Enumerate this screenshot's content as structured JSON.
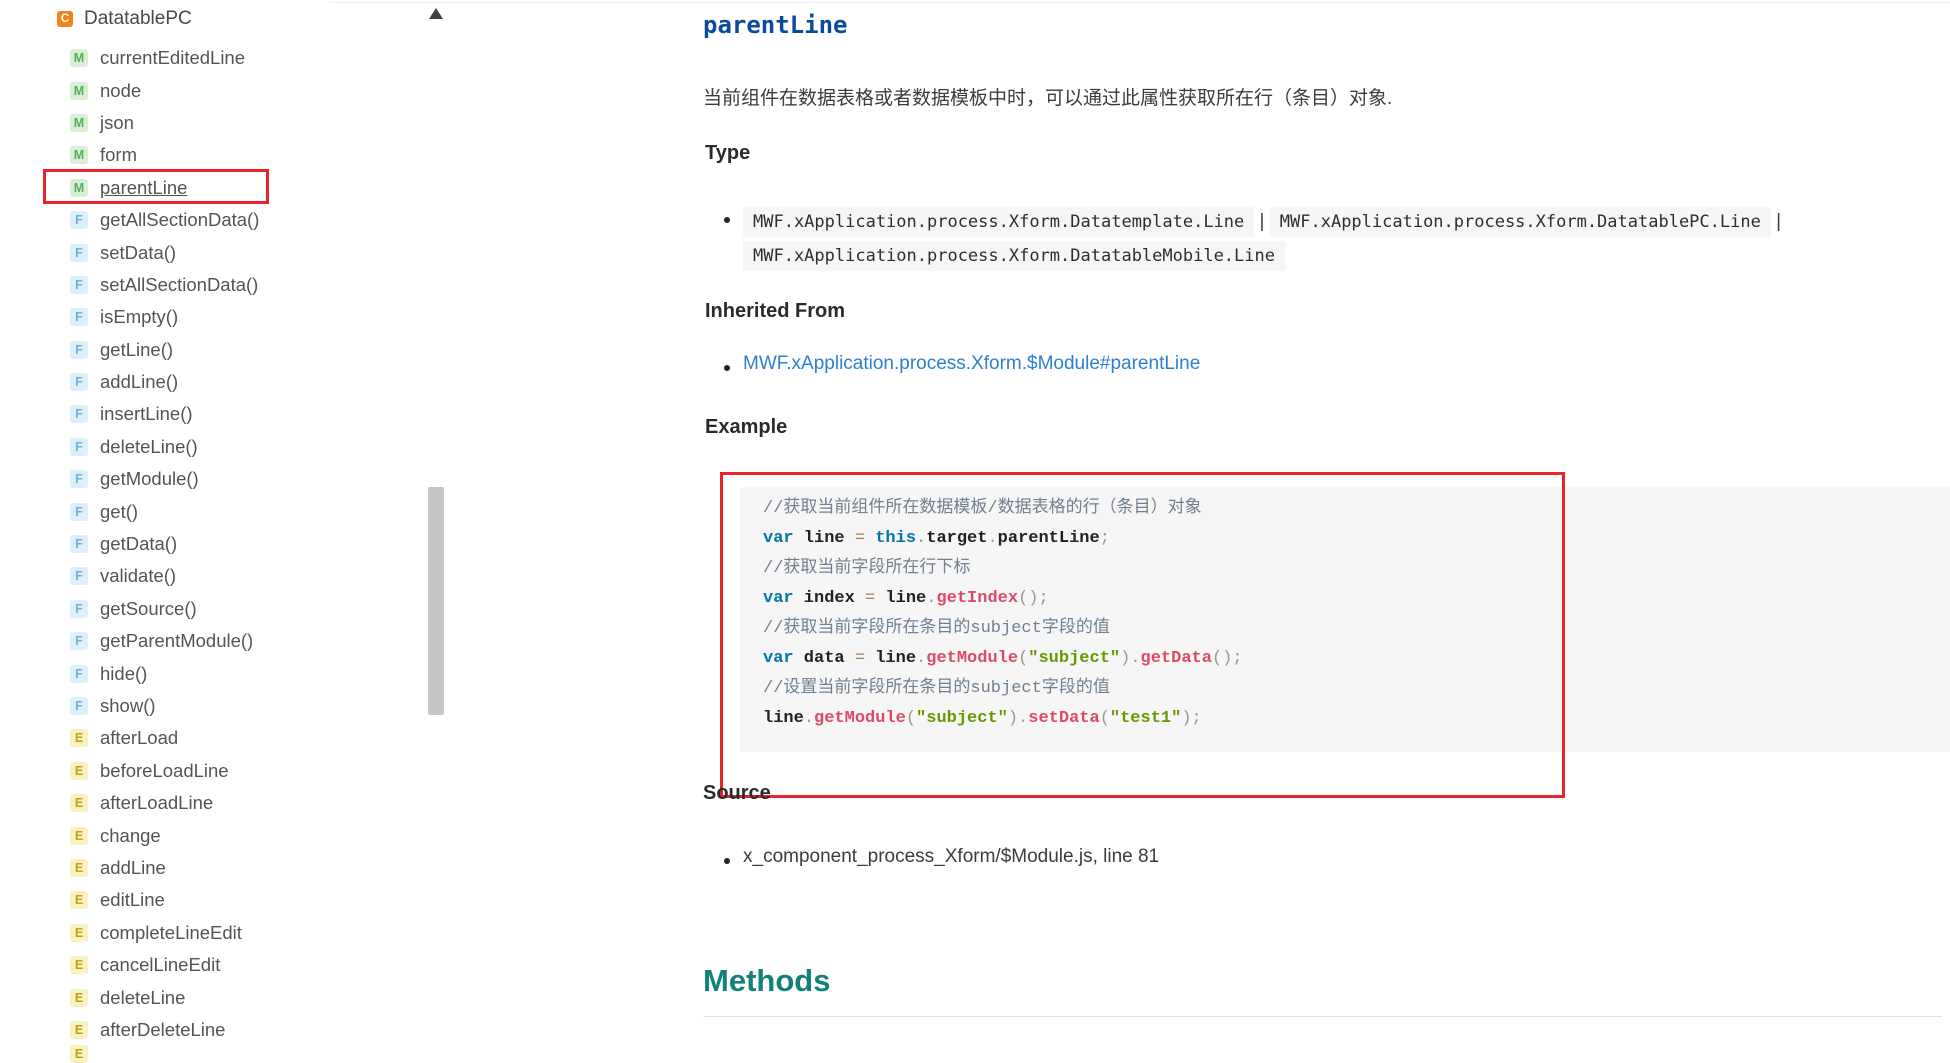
{
  "sidebar": {
    "header": {
      "badge": "C",
      "label": "DatatablePC"
    },
    "items": [
      {
        "badge": "M",
        "label": "currentEditedLine"
      },
      {
        "badge": "M",
        "label": "node"
      },
      {
        "badge": "M",
        "label": "json"
      },
      {
        "badge": "M",
        "label": "form"
      },
      {
        "badge": "M",
        "label": "parentLine",
        "highlighted": true
      },
      {
        "badge": "F",
        "label": "getAllSectionData()"
      },
      {
        "badge": "F",
        "label": "setData()"
      },
      {
        "badge": "F",
        "label": "setAllSectionData()"
      },
      {
        "badge": "F",
        "label": "isEmpty()"
      },
      {
        "badge": "F",
        "label": "getLine()"
      },
      {
        "badge": "F",
        "label": "addLine()"
      },
      {
        "badge": "F",
        "label": "insertLine()"
      },
      {
        "badge": "F",
        "label": "deleteLine()"
      },
      {
        "badge": "F",
        "label": "getModule()"
      },
      {
        "badge": "F",
        "label": "get()"
      },
      {
        "badge": "F",
        "label": "getData()"
      },
      {
        "badge": "F",
        "label": "validate()"
      },
      {
        "badge": "F",
        "label": "getSource()"
      },
      {
        "badge": "F",
        "label": "getParentModule()"
      },
      {
        "badge": "F",
        "label": "hide()"
      },
      {
        "badge": "F",
        "label": "show()"
      },
      {
        "badge": "E",
        "label": "afterLoad"
      },
      {
        "badge": "E",
        "label": "beforeLoadLine"
      },
      {
        "badge": "E",
        "label": "afterLoadLine"
      },
      {
        "badge": "E",
        "label": "change"
      },
      {
        "badge": "E",
        "label": "addLine"
      },
      {
        "badge": "E",
        "label": "editLine"
      },
      {
        "badge": "E",
        "label": "completeLineEdit"
      },
      {
        "badge": "E",
        "label": "cancelLineEdit"
      },
      {
        "badge": "E",
        "label": "deleteLine"
      },
      {
        "badge": "E",
        "label": "afterDeleteLine"
      }
    ],
    "cutoff_item": {
      "badge": "E"
    }
  },
  "content": {
    "title": "parentLine",
    "description": "当前组件在数据表格或者数据模板中时，可以通过此属性获取所在行（条目）对象.",
    "type": {
      "heading": "Type",
      "separator": "|",
      "types": [
        "MWF.xApplication.process.Xform.Datatemplate.Line",
        "MWF.xApplication.process.Xform.DatatablePC.Line",
        "MWF.xApplication.process.Xform.DatatableMobile.Line"
      ]
    },
    "inherited": {
      "heading": "Inherited From",
      "link": "MWF.xApplication.process.Xform.$Module#parentLine"
    },
    "example": {
      "heading": "Example",
      "code_lines": [
        [
          [
            "cm",
            "//获取当前组件所在数据模板/数据表格的行（条目）对象"
          ]
        ],
        [
          [
            "kw",
            "var"
          ],
          [
            "pl",
            " line "
          ],
          [
            "op",
            "="
          ],
          [
            "pl",
            " "
          ],
          [
            "kw",
            "this"
          ],
          [
            "pu",
            "."
          ],
          [
            "pl",
            "target"
          ],
          [
            "pu",
            "."
          ],
          [
            "pl",
            "parentLine"
          ],
          [
            "pu",
            ";"
          ]
        ],
        [
          [
            "cm",
            "//获取当前字段所在行下标"
          ]
        ],
        [
          [
            "kw",
            "var"
          ],
          [
            "pl",
            " index "
          ],
          [
            "op",
            "="
          ],
          [
            "pl",
            " line"
          ],
          [
            "pu",
            "."
          ],
          [
            "fn",
            "getIndex"
          ],
          [
            "pu",
            "();"
          ]
        ],
        [
          [
            "cm",
            "//获取当前字段所在条目的subject字段的值"
          ]
        ],
        [
          [
            "kw",
            "var"
          ],
          [
            "pl",
            " data "
          ],
          [
            "op",
            "="
          ],
          [
            "pl",
            " line"
          ],
          [
            "pu",
            "."
          ],
          [
            "fn",
            "getModule"
          ],
          [
            "pu",
            "("
          ],
          [
            "str",
            "\"subject\""
          ],
          [
            "pu",
            ")."
          ],
          [
            "fn",
            "getData"
          ],
          [
            "pu",
            "();"
          ]
        ],
        [
          [
            "cm",
            "//设置当前字段所在条目的subject字段的值"
          ]
        ],
        [
          [
            "pl",
            "line"
          ],
          [
            "pu",
            "."
          ],
          [
            "fn",
            "getModule"
          ],
          [
            "pu",
            "("
          ],
          [
            "str",
            "\"subject\""
          ],
          [
            "pu",
            ")."
          ],
          [
            "fn",
            "setData"
          ],
          [
            "pu",
            "("
          ],
          [
            "str",
            "\"test1\""
          ],
          [
            "pu",
            ");"
          ]
        ]
      ]
    },
    "source": {
      "heading": "Source",
      "file": "x_component_process_Xform/$Module.js, line 81"
    },
    "methods_heading": "Methods"
  },
  "colors": {
    "annotation_red": "#e8232a",
    "link_blue": "#2d7fd3",
    "methods_teal": "#13807a",
    "title_blue": "#0a4a9b",
    "badge_class_orange": "#f08519",
    "badge_member_green": "#5aad5a",
    "badge_function_blue": "#6db3d9",
    "badge_event_yellow": "#bda416",
    "code_background": "#f6f6f6"
  }
}
